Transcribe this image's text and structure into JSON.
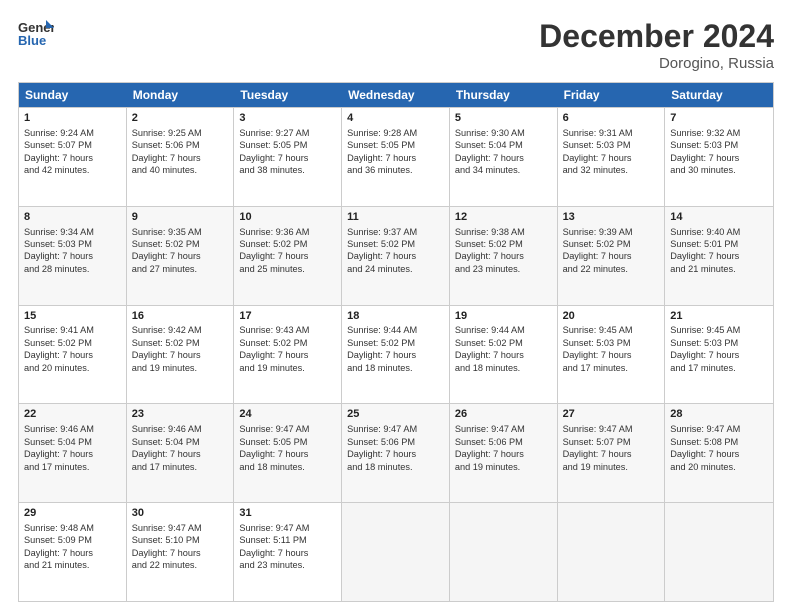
{
  "header": {
    "logo_line1": "General",
    "logo_line2": "Blue",
    "month": "December 2024",
    "location": "Dorogino, Russia"
  },
  "weekdays": [
    "Sunday",
    "Monday",
    "Tuesday",
    "Wednesday",
    "Thursday",
    "Friday",
    "Saturday"
  ],
  "rows": [
    [
      {
        "day": "1",
        "lines": [
          "Sunrise: 9:24 AM",
          "Sunset: 5:07 PM",
          "Daylight: 7 hours",
          "and 42 minutes."
        ]
      },
      {
        "day": "2",
        "lines": [
          "Sunrise: 9:25 AM",
          "Sunset: 5:06 PM",
          "Daylight: 7 hours",
          "and 40 minutes."
        ]
      },
      {
        "day": "3",
        "lines": [
          "Sunrise: 9:27 AM",
          "Sunset: 5:05 PM",
          "Daylight: 7 hours",
          "and 38 minutes."
        ]
      },
      {
        "day": "4",
        "lines": [
          "Sunrise: 9:28 AM",
          "Sunset: 5:05 PM",
          "Daylight: 7 hours",
          "and 36 minutes."
        ]
      },
      {
        "day": "5",
        "lines": [
          "Sunrise: 9:30 AM",
          "Sunset: 5:04 PM",
          "Daylight: 7 hours",
          "and 34 minutes."
        ]
      },
      {
        "day": "6",
        "lines": [
          "Sunrise: 9:31 AM",
          "Sunset: 5:03 PM",
          "Daylight: 7 hours",
          "and 32 minutes."
        ]
      },
      {
        "day": "7",
        "lines": [
          "Sunrise: 9:32 AM",
          "Sunset: 5:03 PM",
          "Daylight: 7 hours",
          "and 30 minutes."
        ]
      }
    ],
    [
      {
        "day": "8",
        "lines": [
          "Sunrise: 9:34 AM",
          "Sunset: 5:03 PM",
          "Daylight: 7 hours",
          "and 28 minutes."
        ]
      },
      {
        "day": "9",
        "lines": [
          "Sunrise: 9:35 AM",
          "Sunset: 5:02 PM",
          "Daylight: 7 hours",
          "and 27 minutes."
        ]
      },
      {
        "day": "10",
        "lines": [
          "Sunrise: 9:36 AM",
          "Sunset: 5:02 PM",
          "Daylight: 7 hours",
          "and 25 minutes."
        ]
      },
      {
        "day": "11",
        "lines": [
          "Sunrise: 9:37 AM",
          "Sunset: 5:02 PM",
          "Daylight: 7 hours",
          "and 24 minutes."
        ]
      },
      {
        "day": "12",
        "lines": [
          "Sunrise: 9:38 AM",
          "Sunset: 5:02 PM",
          "Daylight: 7 hours",
          "and 23 minutes."
        ]
      },
      {
        "day": "13",
        "lines": [
          "Sunrise: 9:39 AM",
          "Sunset: 5:02 PM",
          "Daylight: 7 hours",
          "and 22 minutes."
        ]
      },
      {
        "day": "14",
        "lines": [
          "Sunrise: 9:40 AM",
          "Sunset: 5:01 PM",
          "Daylight: 7 hours",
          "and 21 minutes."
        ]
      }
    ],
    [
      {
        "day": "15",
        "lines": [
          "Sunrise: 9:41 AM",
          "Sunset: 5:02 PM",
          "Daylight: 7 hours",
          "and 20 minutes."
        ]
      },
      {
        "day": "16",
        "lines": [
          "Sunrise: 9:42 AM",
          "Sunset: 5:02 PM",
          "Daylight: 7 hours",
          "and 19 minutes."
        ]
      },
      {
        "day": "17",
        "lines": [
          "Sunrise: 9:43 AM",
          "Sunset: 5:02 PM",
          "Daylight: 7 hours",
          "and 19 minutes."
        ]
      },
      {
        "day": "18",
        "lines": [
          "Sunrise: 9:44 AM",
          "Sunset: 5:02 PM",
          "Daylight: 7 hours",
          "and 18 minutes."
        ]
      },
      {
        "day": "19",
        "lines": [
          "Sunrise: 9:44 AM",
          "Sunset: 5:02 PM",
          "Daylight: 7 hours",
          "and 18 minutes."
        ]
      },
      {
        "day": "20",
        "lines": [
          "Sunrise: 9:45 AM",
          "Sunset: 5:03 PM",
          "Daylight: 7 hours",
          "and 17 minutes."
        ]
      },
      {
        "day": "21",
        "lines": [
          "Sunrise: 9:45 AM",
          "Sunset: 5:03 PM",
          "Daylight: 7 hours",
          "and 17 minutes."
        ]
      }
    ],
    [
      {
        "day": "22",
        "lines": [
          "Sunrise: 9:46 AM",
          "Sunset: 5:04 PM",
          "Daylight: 7 hours",
          "and 17 minutes."
        ]
      },
      {
        "day": "23",
        "lines": [
          "Sunrise: 9:46 AM",
          "Sunset: 5:04 PM",
          "Daylight: 7 hours",
          "and 17 minutes."
        ]
      },
      {
        "day": "24",
        "lines": [
          "Sunrise: 9:47 AM",
          "Sunset: 5:05 PM",
          "Daylight: 7 hours",
          "and 18 minutes."
        ]
      },
      {
        "day": "25",
        "lines": [
          "Sunrise: 9:47 AM",
          "Sunset: 5:06 PM",
          "Daylight: 7 hours",
          "and 18 minutes."
        ]
      },
      {
        "day": "26",
        "lines": [
          "Sunrise: 9:47 AM",
          "Sunset: 5:06 PM",
          "Daylight: 7 hours",
          "and 19 minutes."
        ]
      },
      {
        "day": "27",
        "lines": [
          "Sunrise: 9:47 AM",
          "Sunset: 5:07 PM",
          "Daylight: 7 hours",
          "and 19 minutes."
        ]
      },
      {
        "day": "28",
        "lines": [
          "Sunrise: 9:47 AM",
          "Sunset: 5:08 PM",
          "Daylight: 7 hours",
          "and 20 minutes."
        ]
      }
    ],
    [
      {
        "day": "29",
        "lines": [
          "Sunrise: 9:48 AM",
          "Sunset: 5:09 PM",
          "Daylight: 7 hours",
          "and 21 minutes."
        ]
      },
      {
        "day": "30",
        "lines": [
          "Sunrise: 9:47 AM",
          "Sunset: 5:10 PM",
          "Daylight: 7 hours",
          "and 22 minutes."
        ]
      },
      {
        "day": "31",
        "lines": [
          "Sunrise: 9:47 AM",
          "Sunset: 5:11 PM",
          "Daylight: 7 hours",
          "and 23 minutes."
        ]
      },
      {
        "day": "",
        "lines": []
      },
      {
        "day": "",
        "lines": []
      },
      {
        "day": "",
        "lines": []
      },
      {
        "day": "",
        "lines": []
      }
    ]
  ]
}
